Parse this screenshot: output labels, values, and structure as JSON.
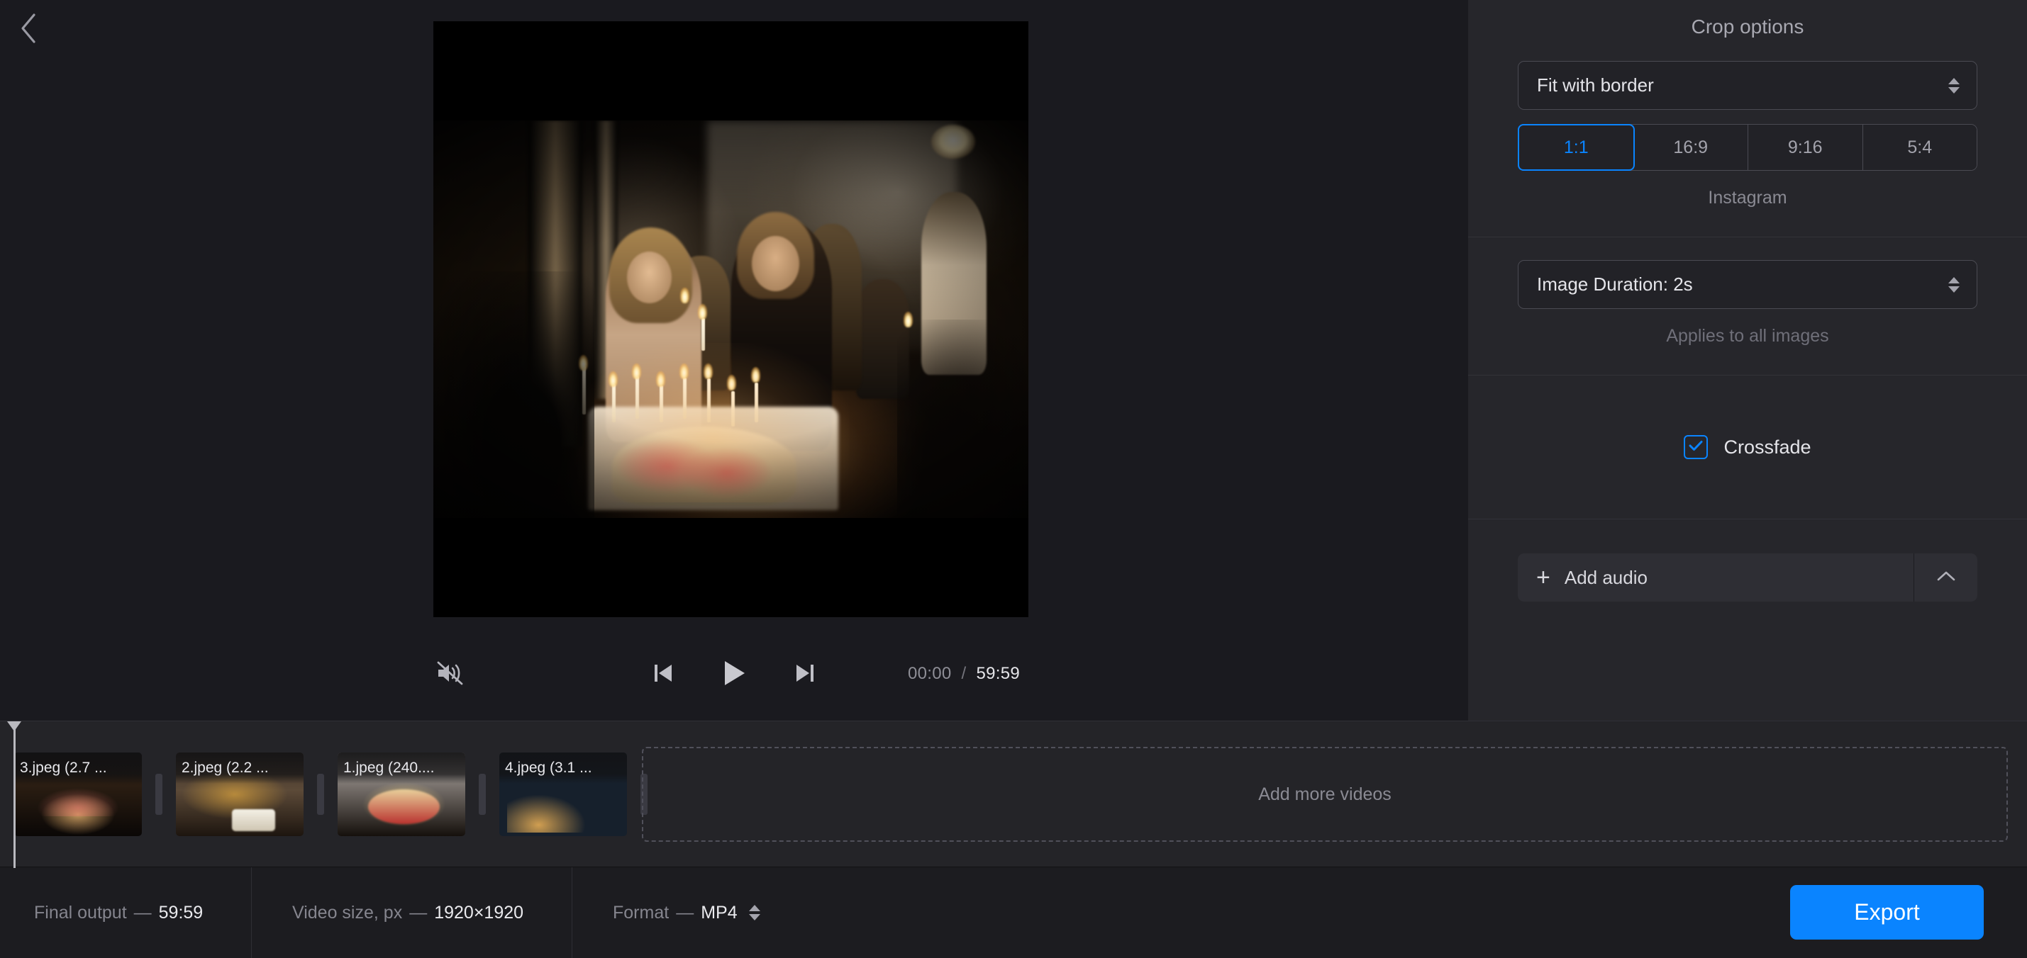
{
  "nav": {
    "back_icon": "chevron-left-icon"
  },
  "preview": {
    "aspect": "1:1",
    "scene_description": "Birthday celebration with candle-lit cake"
  },
  "player": {
    "mute_icon": "speaker-muted-icon",
    "prev_icon": "skip-previous-icon",
    "play_icon": "play-icon",
    "next_icon": "skip-next-icon",
    "current_time": "00:00",
    "separator": "/",
    "total_time": "59:59"
  },
  "timeline": {
    "clips": [
      {
        "label": "3.jpeg (2.7 ...",
        "art": "th1"
      },
      {
        "label": "2.jpeg (2.2 ...",
        "art": "th2"
      },
      {
        "label": "1.jpeg (240....",
        "art": "th3"
      },
      {
        "label": "4.jpeg (3.1 ...",
        "art": "th4"
      }
    ],
    "dropzone_label": "Add more videos"
  },
  "right_panel": {
    "title": "Crop options",
    "crop_mode": {
      "value": "Fit with border",
      "stepper_icon": "updown-stepper-icon"
    },
    "aspect_ratios": [
      {
        "label": "1:1",
        "active": true
      },
      {
        "label": "16:9",
        "active": false
      },
      {
        "label": "9:16",
        "active": false
      },
      {
        "label": "5:4",
        "active": false
      }
    ],
    "aspect_hint": "Instagram",
    "image_duration": {
      "value": "Image Duration: 2s",
      "hint": "Applies to all images",
      "stepper_icon": "updown-stepper-icon"
    },
    "crossfade": {
      "label": "Crossfade",
      "checked": true,
      "check_icon": "checkmark-icon"
    },
    "audio": {
      "plus_icon": "plus-icon",
      "label": "Add audio",
      "toggle_icon": "chevron-up-icon"
    }
  },
  "bottom_bar": {
    "final_output": {
      "label": "Final output",
      "dash": "—",
      "value": "59:59"
    },
    "video_size": {
      "label": "Video size, px",
      "dash": "—",
      "value": "1920×1920"
    },
    "format": {
      "label": "Format",
      "dash": "—",
      "value": "MP4",
      "stepper_icon": "updown-stepper-icon"
    },
    "export_label": "Export"
  },
  "colors": {
    "accent": "#0a84ff",
    "panel_bg": "#26262b",
    "main_bg": "#1a1a1f",
    "timeline_bg": "#242428"
  }
}
